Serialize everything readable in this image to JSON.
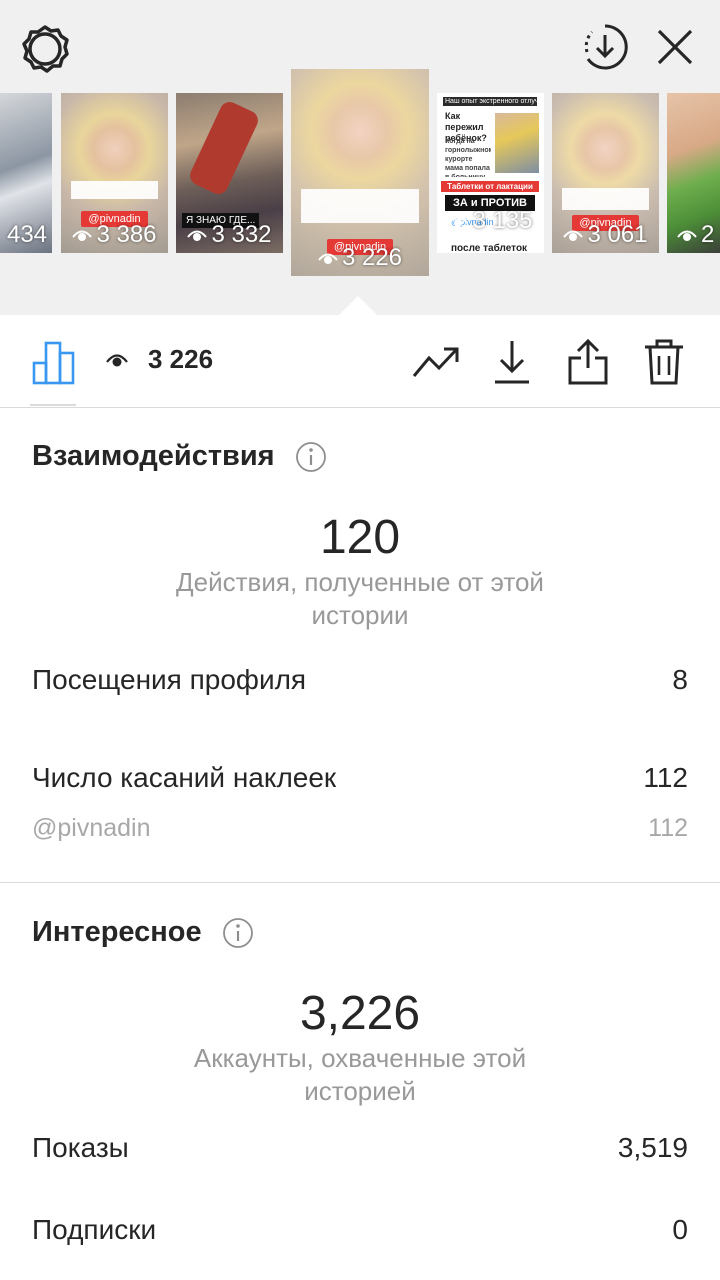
{
  "header": {
    "settings_icon": "gear-icon",
    "download_icon": "download-circle-icon",
    "close_icon": "close-icon"
  },
  "stories": [
    {
      "views": "434",
      "show_eye": false
    },
    {
      "views": "3 386",
      "show_eye": true
    },
    {
      "views": "3 332",
      "show_eye": true,
      "caption": "Я ЗНАЮ ГДЕ..."
    },
    {
      "views": "3 226",
      "show_eye": true,
      "current": true
    },
    {
      "views": "3 135",
      "show_eye": true
    },
    {
      "views": "3 061",
      "show_eye": true
    },
    {
      "views": "2",
      "show_eye": true
    }
  ],
  "story_texts": {
    "handle": "@pivnadin",
    "s5_top": "Наш опыт экстренного отлучения",
    "s5_q1": "Как пережил ребёнок?",
    "s5_q2": "Когда на горнолыжном курорте мама попала в больницу...",
    "s5_red": "Таблетки от лактации",
    "s5_black": "ЗА и ПРОТИВ",
    "s5_bottom": "после таблеток"
  },
  "action_bar": {
    "views_label": "3 226"
  },
  "interactions": {
    "title": "Взаимодействия",
    "total": "120",
    "caption": "Действия, полученные от этой истории",
    "rows": [
      {
        "label": "Посещения профиля",
        "value": "8"
      },
      {
        "label": "Число касаний наклеек",
        "value": "112"
      }
    ],
    "sub_row": {
      "label": "@pivnadin",
      "value": "112"
    }
  },
  "discovery": {
    "title": "Интересное",
    "total": "3,226",
    "caption": "Аккаунты, охваченные этой историей",
    "rows": [
      {
        "label": "Показы",
        "value": "3,519"
      },
      {
        "label": "Подписки",
        "value": "0"
      }
    ]
  },
  "colors": {
    "accent": "#3897f0",
    "text": "#262626",
    "muted": "#999999",
    "story_red": "#e53935"
  }
}
